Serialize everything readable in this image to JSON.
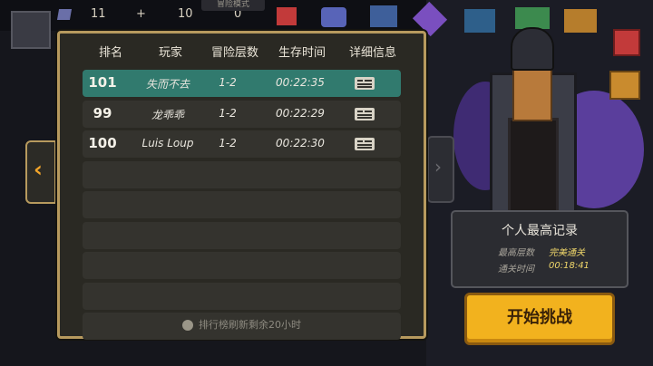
{
  "hud": {
    "gems": "11",
    "plus": "+",
    "count_a": "10",
    "count_b": "0",
    "mode_label": "冒险模式"
  },
  "leaderboard": {
    "columns": [
      "排名",
      "玩家",
      "冒险层数",
      "生存时间",
      "详细信息"
    ],
    "rows": [
      {
        "rank": "101",
        "player": "失而不去",
        "level": "1-2",
        "time": "00:22:35",
        "selected": true
      },
      {
        "rank": "99",
        "player": "龙乖乖",
        "level": "1-2",
        "time": "00:22:29",
        "selected": false
      },
      {
        "rank": "100",
        "player": "Luis Loup",
        "level": "1-2",
        "time": "00:22:30",
        "selected": false
      }
    ],
    "empty_rows": 6,
    "refresh_note": "排行榜刷新剩余20小时"
  },
  "record": {
    "title": "个人最高记录",
    "best_level_label": "最高层数",
    "best_level_value": "完美通关",
    "clear_time_label": "通关时间",
    "clear_time_value": "00:18:41"
  },
  "start_button": "开始挑战",
  "colors": {
    "panel_border": "#b79a5e",
    "selected_row": "#317a6e",
    "accent_yellow": "#f2b21e"
  }
}
